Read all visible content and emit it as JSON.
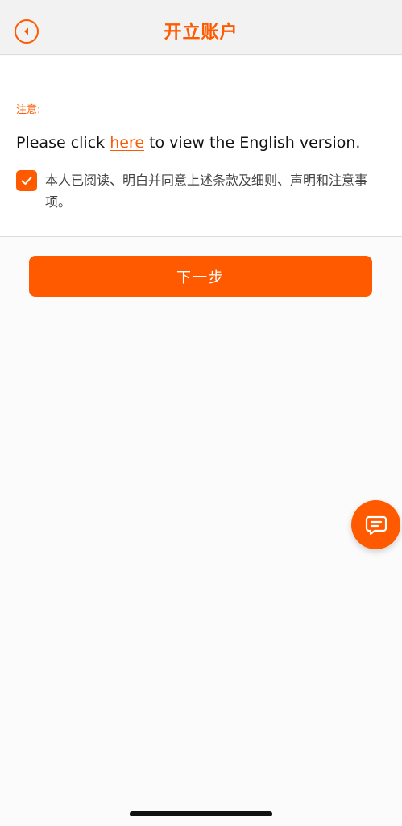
{
  "header": {
    "title": "开立账户",
    "back_icon": "back-arrow-icon"
  },
  "notice": {
    "label": "注意:",
    "english_prefix": "Please click ",
    "english_link": "here",
    "english_suffix": " to view the English version."
  },
  "agreement": {
    "checked": true,
    "text": "本人已阅读、明白并同意上述条款及细则、声明和注意事项。"
  },
  "actions": {
    "next_label": "下一步"
  },
  "chat": {
    "icon": "chat-bubble-icon"
  },
  "colors": {
    "accent": "#ff5a00",
    "header_bg": "#f2f2f2",
    "page_bg": "#fbfbfb"
  }
}
